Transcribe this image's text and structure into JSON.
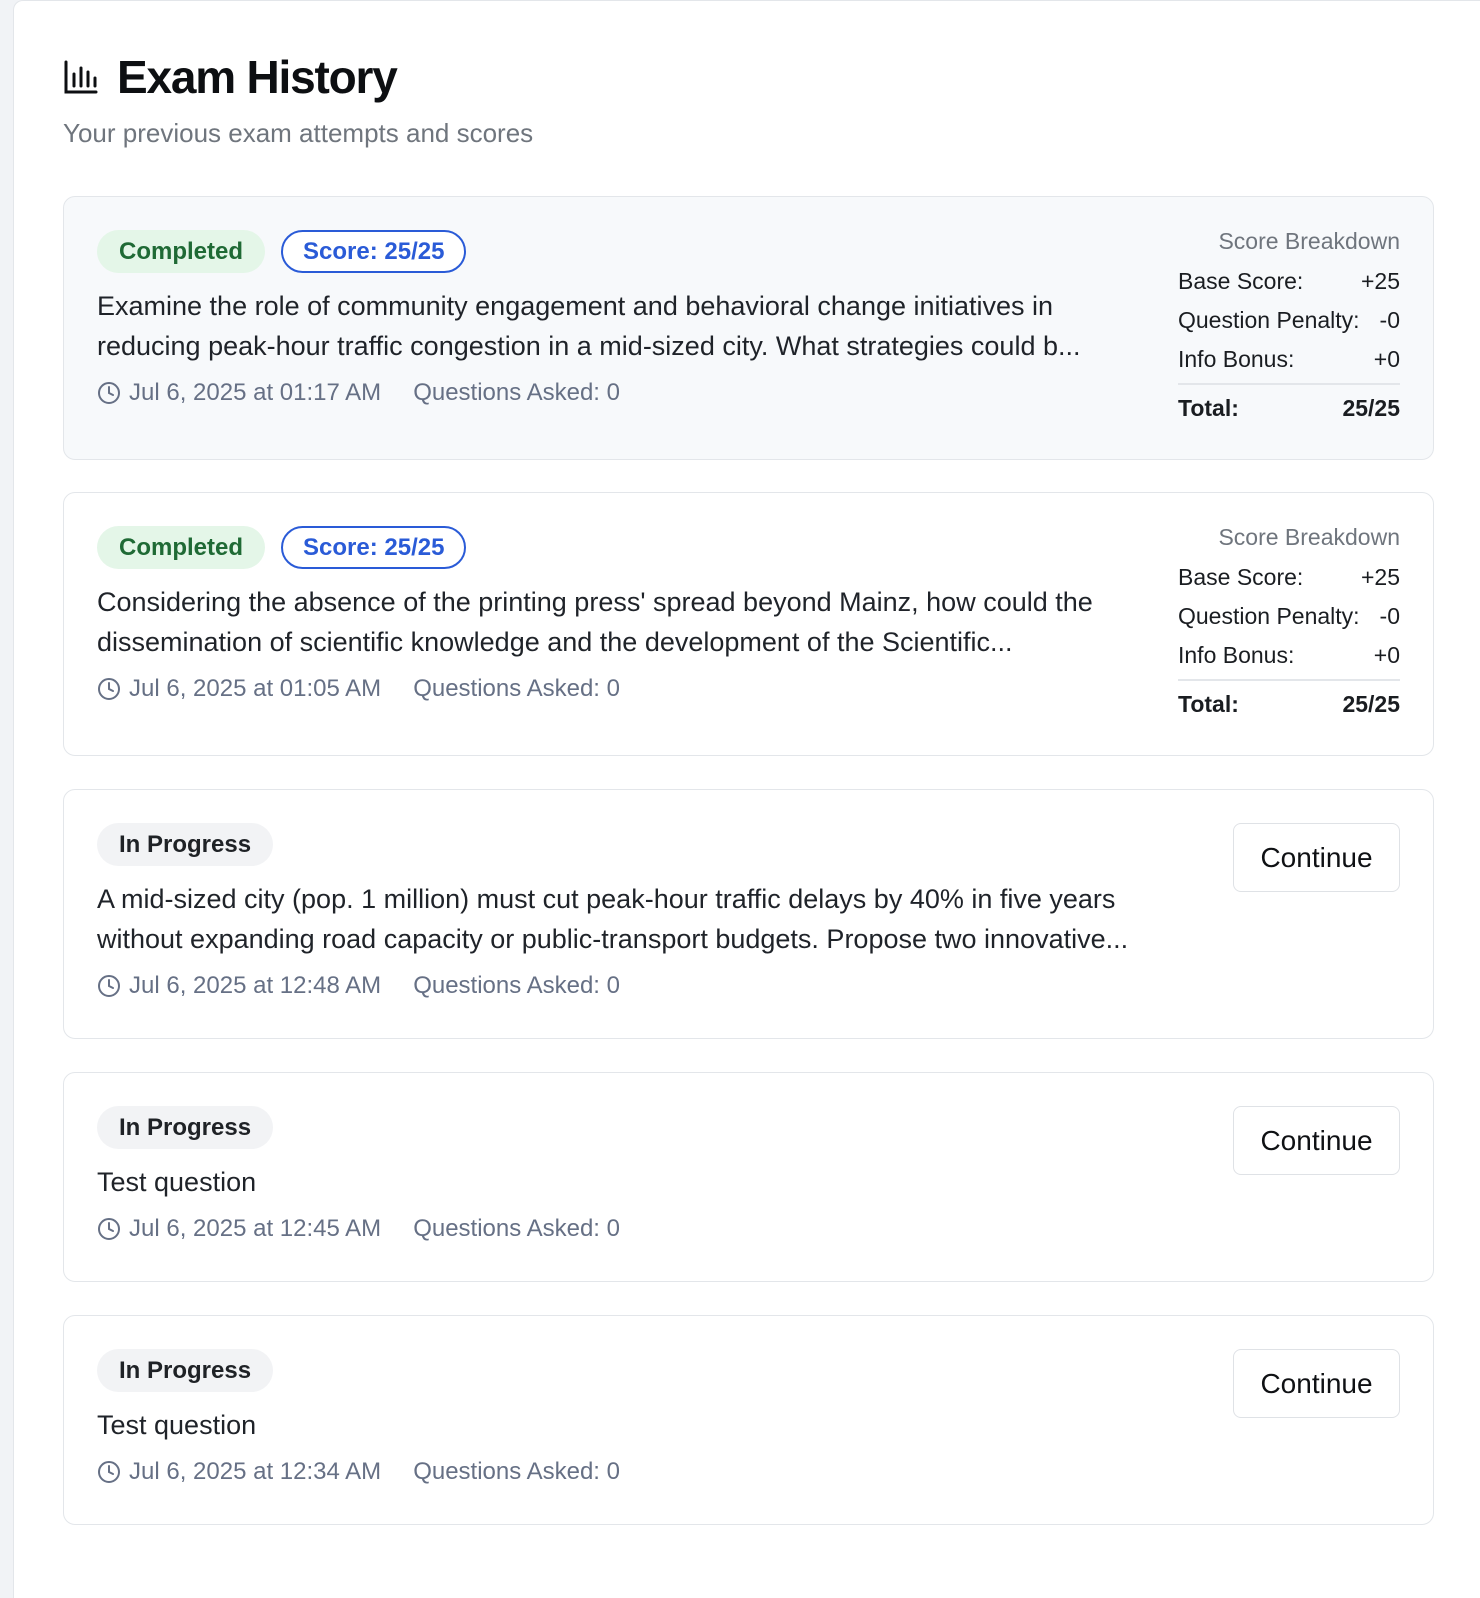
{
  "header": {
    "icon": "bar-chart-icon",
    "title": "Exam History",
    "subtitle": "Your previous exam attempts and scores"
  },
  "exams": [
    {
      "status": "Completed",
      "score_badge": "Score: 25/25",
      "question": "Examine the role of community engagement and behavioral change initiatives in reducing peak-hour traffic congestion in a mid-sized city. What strategies could b...",
      "date": "Jul 6, 2025 at 01:17 AM",
      "questions_asked": "Questions Asked: 0",
      "breakdown": {
        "title": "Score Breakdown",
        "base_label": "Base Score:",
        "base_value": "+25",
        "penalty_label": "Question Penalty:",
        "penalty_value": "-0",
        "bonus_label": "Info Bonus:",
        "bonus_value": "+0",
        "total_label": "Total:",
        "total_value": "25/25"
      }
    },
    {
      "status": "Completed",
      "score_badge": "Score: 25/25",
      "question": "Considering the absence of the printing press' spread beyond Mainz, how could the dissemination of scientific knowledge and the development of the Scientific...",
      "date": "Jul 6, 2025 at 01:05 AM",
      "questions_asked": "Questions Asked: 0",
      "breakdown": {
        "title": "Score Breakdown",
        "base_label": "Base Score:",
        "base_value": "+25",
        "penalty_label": "Question Penalty:",
        "penalty_value": "-0",
        "bonus_label": "Info Bonus:",
        "bonus_value": "+0",
        "total_label": "Total:",
        "total_value": "25/25"
      }
    },
    {
      "status": "In Progress",
      "question": "A mid-sized city (pop. 1 million) must cut peak-hour traffic delays by 40% in five years without expanding road capacity or public-transport budgets. Propose two innovative...",
      "date": "Jul 6, 2025 at 12:48 AM",
      "questions_asked": "Questions Asked: 0",
      "action_label": "Continue"
    },
    {
      "status": "In Progress",
      "question": "Test question",
      "date": "Jul 6, 2025 at 12:45 AM",
      "questions_asked": "Questions Asked: 0",
      "action_label": "Continue"
    },
    {
      "status": "In Progress",
      "question": "Test question",
      "date": "Jul 6, 2025 at 12:34 AM",
      "questions_asked": "Questions Asked: 0",
      "action_label": "Continue"
    }
  ],
  "colors": {
    "completed_bg": "#e4f6e8",
    "completed_text": "#1f6a35",
    "score_accent": "#2a5bd7",
    "in_progress_bg": "#f2f3f5",
    "muted_text": "#667085"
  }
}
